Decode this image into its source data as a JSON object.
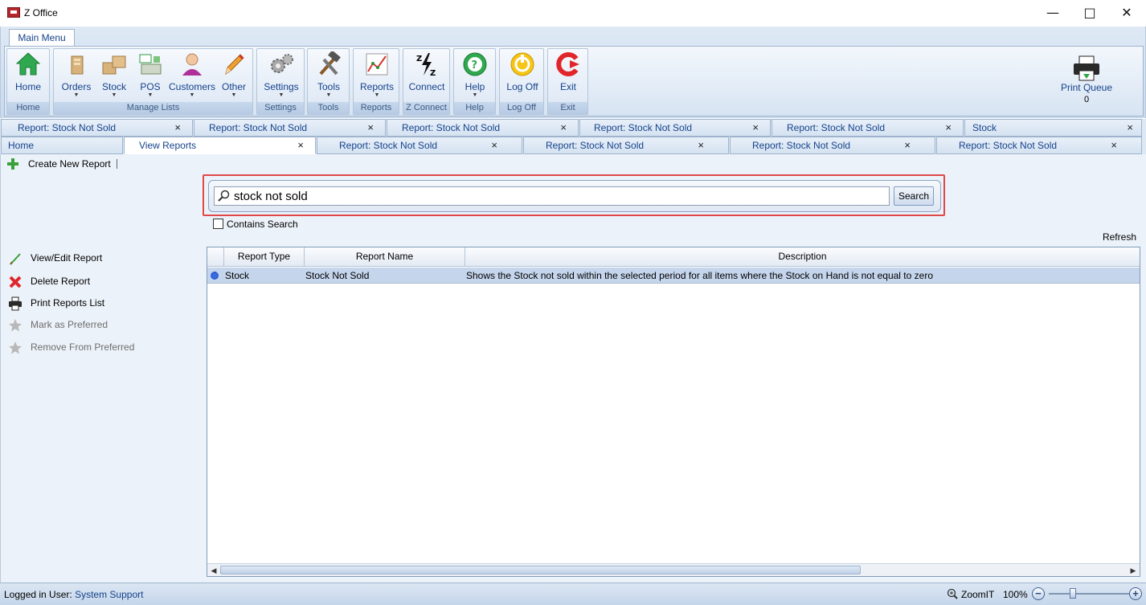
{
  "window": {
    "title": "Z Office",
    "minimize_icon": "minimize-icon",
    "maximize_icon": "maximize-icon",
    "close_icon": "close-icon"
  },
  "ribbon": {
    "tab": "Main Menu",
    "groups": [
      {
        "label": "Home",
        "buttons": [
          {
            "label": "Home",
            "icon": "house-icon"
          }
        ]
      },
      {
        "label": "Manage Lists",
        "buttons": [
          {
            "label": "Orders",
            "icon": "orders-icon",
            "dropdown": true
          },
          {
            "label": "Stock",
            "icon": "boxes-icon",
            "dropdown": true
          },
          {
            "label": "POS",
            "icon": "cash-register-icon",
            "dropdown": true
          },
          {
            "label": "Customers",
            "icon": "person-icon",
            "dropdown": true
          },
          {
            "label": "Other",
            "icon": "pencil-icon",
            "dropdown": true
          }
        ]
      },
      {
        "label": "Settings",
        "buttons": [
          {
            "label": "Settings",
            "icon": "gears-icon",
            "dropdown": true
          }
        ]
      },
      {
        "label": "Tools",
        "buttons": [
          {
            "label": "Tools",
            "icon": "hammer-wrench-icon",
            "dropdown": true
          }
        ]
      },
      {
        "label": "Reports",
        "buttons": [
          {
            "label": "Reports",
            "icon": "chart-icon",
            "dropdown": true
          }
        ]
      },
      {
        "label": "Z Connect",
        "buttons": [
          {
            "label": "Connect",
            "icon": "zz-lightning-icon"
          }
        ]
      },
      {
        "label": "Help",
        "buttons": [
          {
            "label": "Help",
            "icon": "help-icon",
            "dropdown": true
          }
        ]
      },
      {
        "label": "Log Off",
        "buttons": [
          {
            "label": "Log Off",
            "icon": "logoff-icon"
          }
        ]
      },
      {
        "label": "Exit",
        "buttons": [
          {
            "label": "Exit",
            "icon": "exit-icon"
          }
        ]
      }
    ],
    "print_queue": {
      "label": "Print Queue",
      "count": "0",
      "icon": "printer-icon"
    }
  },
  "tabs_row1": [
    {
      "label": "Report: Stock Not Sold"
    },
    {
      "label": "Report: Stock Not Sold"
    },
    {
      "label": "Report: Stock Not Sold"
    },
    {
      "label": "Report: Stock Not Sold"
    },
    {
      "label": "Report: Stock Not Sold"
    },
    {
      "label": "Stock"
    }
  ],
  "tabs_row2": [
    {
      "label": "Home"
    },
    {
      "label": "View Reports",
      "active": true
    },
    {
      "label": "Report: Stock Not Sold"
    },
    {
      "label": "Report: Stock Not Sold"
    },
    {
      "label": "Report: Stock Not Sold"
    },
    {
      "label": "Report: Stock Not Sold"
    }
  ],
  "tab_close": "×",
  "toolbar": {
    "create_new_report": "Create New Report"
  },
  "search": {
    "value": "stock not sold",
    "button": "Search",
    "contains_search": "Contains Search",
    "contains_checked": false
  },
  "refresh": "Refresh",
  "actions": [
    {
      "label": "View/Edit Report",
      "icon": "pencil-icon",
      "enabled": true
    },
    {
      "label": "Delete Report",
      "icon": "red-x-icon",
      "enabled": true
    },
    {
      "label": "Print Reports List",
      "icon": "printer-icon",
      "enabled": true
    },
    {
      "label": "Mark as Preferred",
      "icon": "star-icon",
      "enabled": false
    },
    {
      "label": "Remove From Preferred",
      "icon": "star-icon",
      "enabled": false
    }
  ],
  "grid": {
    "columns": [
      "Report Type",
      "Report Name",
      "Description"
    ],
    "rows": [
      {
        "type": "Stock",
        "name": "Stock Not Sold",
        "description": "Shows the Stock not sold within the selected period for all items where the Stock on Hand is not equal to zero",
        "selected": true
      }
    ]
  },
  "status": {
    "logged_in_label": "Logged in User:",
    "user": "System Support",
    "zoom_label": "ZoomIT",
    "zoom_percent": "100%",
    "zoom_minus": "−",
    "zoom_plus": "+"
  },
  "colors": {
    "accent": "#15428b",
    "ribbon_bg": "#dbe6f4",
    "highlight_border": "#e04848",
    "selected_row": "#c5d5ec"
  }
}
